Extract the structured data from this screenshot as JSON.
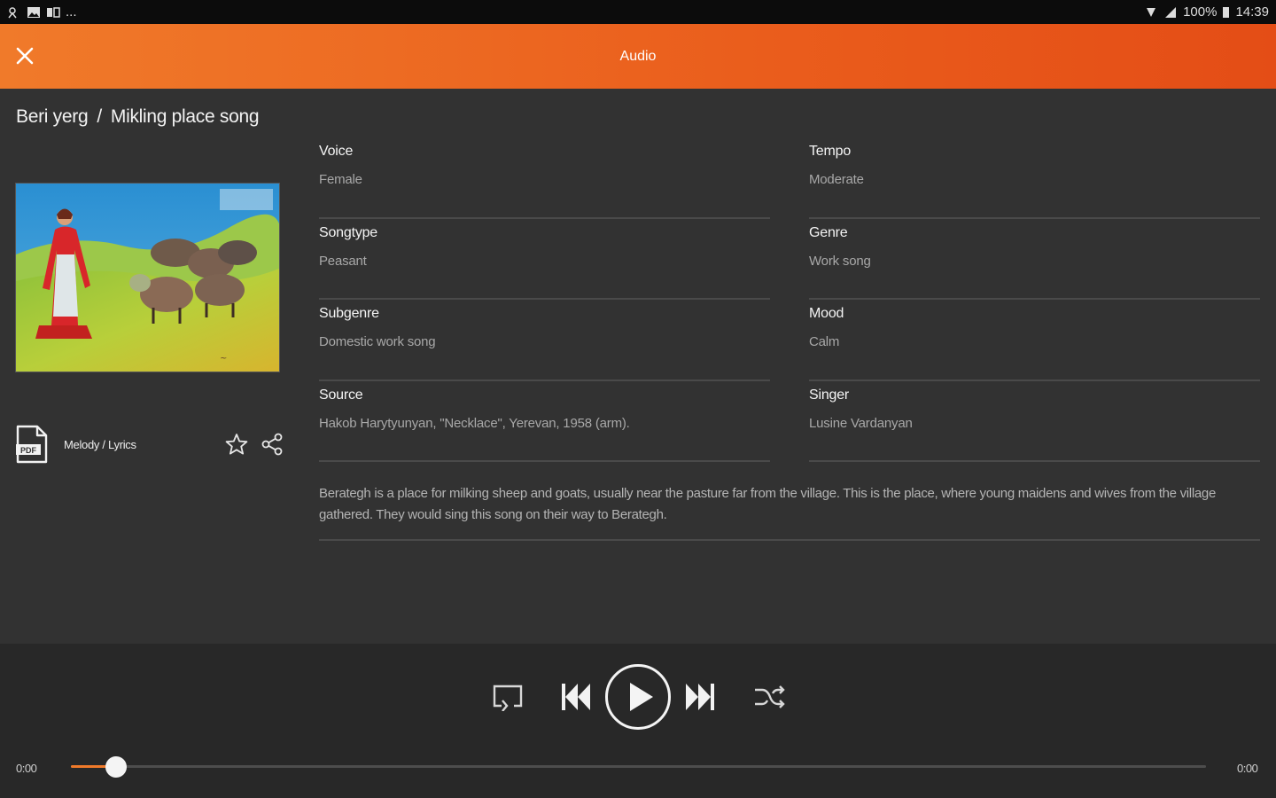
{
  "status_bar": {
    "time": "14:39",
    "battery": "100%",
    "left_icons": [
      "notification-icon",
      "image-icon",
      "app-icon"
    ],
    "overflow": "..."
  },
  "app_bar": {
    "title": "Audio",
    "close_icon": "close-icon"
  },
  "breadcrumb": {
    "parent": "Beri yerg",
    "separator": "/",
    "current": "Mikling place song"
  },
  "melody": {
    "label": "Melody / Lyrics",
    "pdf_text": "PDF"
  },
  "details": [
    {
      "key": "Voice",
      "value": "Female"
    },
    {
      "key": "Tempo",
      "value": "Moderate"
    },
    {
      "key": "Songtype",
      "value": "Peasant"
    },
    {
      "key": "Genre",
      "value": "Work song"
    },
    {
      "key": "Subgenre",
      "value": "Domestic work song"
    },
    {
      "key": "Mood",
      "value": "Calm"
    },
    {
      "key": "Source",
      "value": "Hakob Harytyunyan, \"Necklace\", Yerevan, 1958 (arm)."
    },
    {
      "key": "Singer",
      "value": "Lusine Vardanyan"
    }
  ],
  "description": "Berategh is a place for milking sheep and goats, usually near the pasture far from the village. This is the place, where young maidens and wives from the village gathered. They would sing this song on their way to Berategh.",
  "player": {
    "elapsed": "0:00",
    "duration": "0:00",
    "progress": 0.04,
    "accent": "#f07a2a"
  },
  "colors": {
    "app_bar": "#ea5d1c",
    "background": "#323232",
    "player_bg": "#282828"
  }
}
